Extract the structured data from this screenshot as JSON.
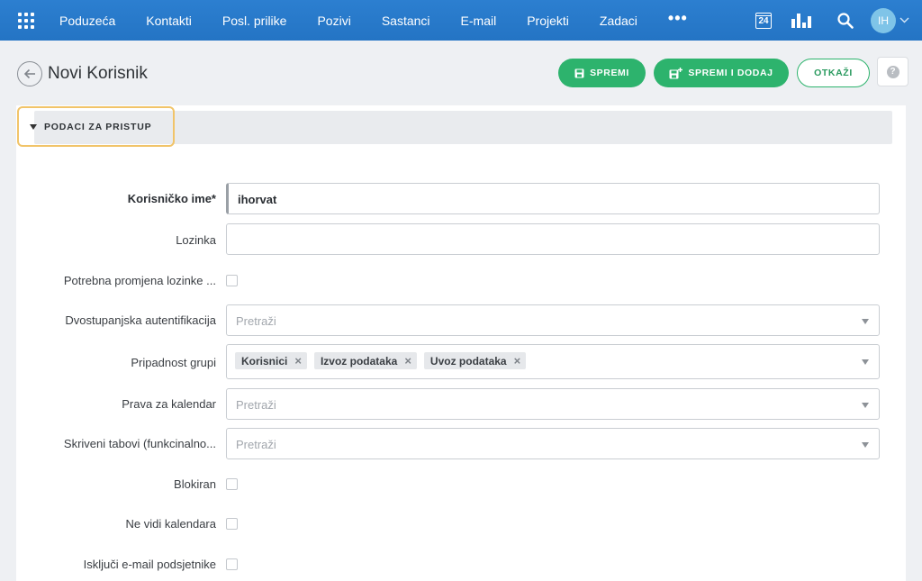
{
  "nav": {
    "items": [
      "Poduzeća",
      "Kontakti",
      "Posl. prilike",
      "Pozivi",
      "Sastanci",
      "E-mail",
      "Projekti",
      "Zadaci"
    ],
    "more": "•••",
    "calendar_day": "24",
    "user_initials": "IH"
  },
  "header": {
    "title": "Novi Korisnik",
    "save_label": "SPREMI",
    "save_add_label": "SPREMI I DODAJ",
    "cancel_label": "OTKAŽI",
    "help": "?"
  },
  "section": {
    "title": "PODACI ZA PRISTUP"
  },
  "form": {
    "username": {
      "label": "Korisničko ime*",
      "value": "ihorvat"
    },
    "password": {
      "label": "Lozinka",
      "value": ""
    },
    "password_change": {
      "label": "Potrebna promjena lozinke ..."
    },
    "two_factor": {
      "label": "Dvostupanjska autentifikacija",
      "placeholder": "Pretraži"
    },
    "groups": {
      "label": "Pripadnost grupi",
      "tags": [
        "Korisnici",
        "Izvoz podataka",
        "Uvoz podataka"
      ]
    },
    "calendar_rights": {
      "label": "Prava za kalendar",
      "placeholder": "Pretraži"
    },
    "hidden_tabs": {
      "label": "Skriveni tabovi (funkcinalno...",
      "placeholder": "Pretraži"
    },
    "blocked": {
      "label": "Blokiran"
    },
    "no_calendar": {
      "label": "Ne vidi kalendara"
    },
    "no_email_reminders": {
      "label": "Isključi e-mail podsjetnike"
    }
  },
  "colors": {
    "nav_bg": "#2474c4",
    "primary_green": "#2db36d",
    "highlight": "#f1c469"
  }
}
